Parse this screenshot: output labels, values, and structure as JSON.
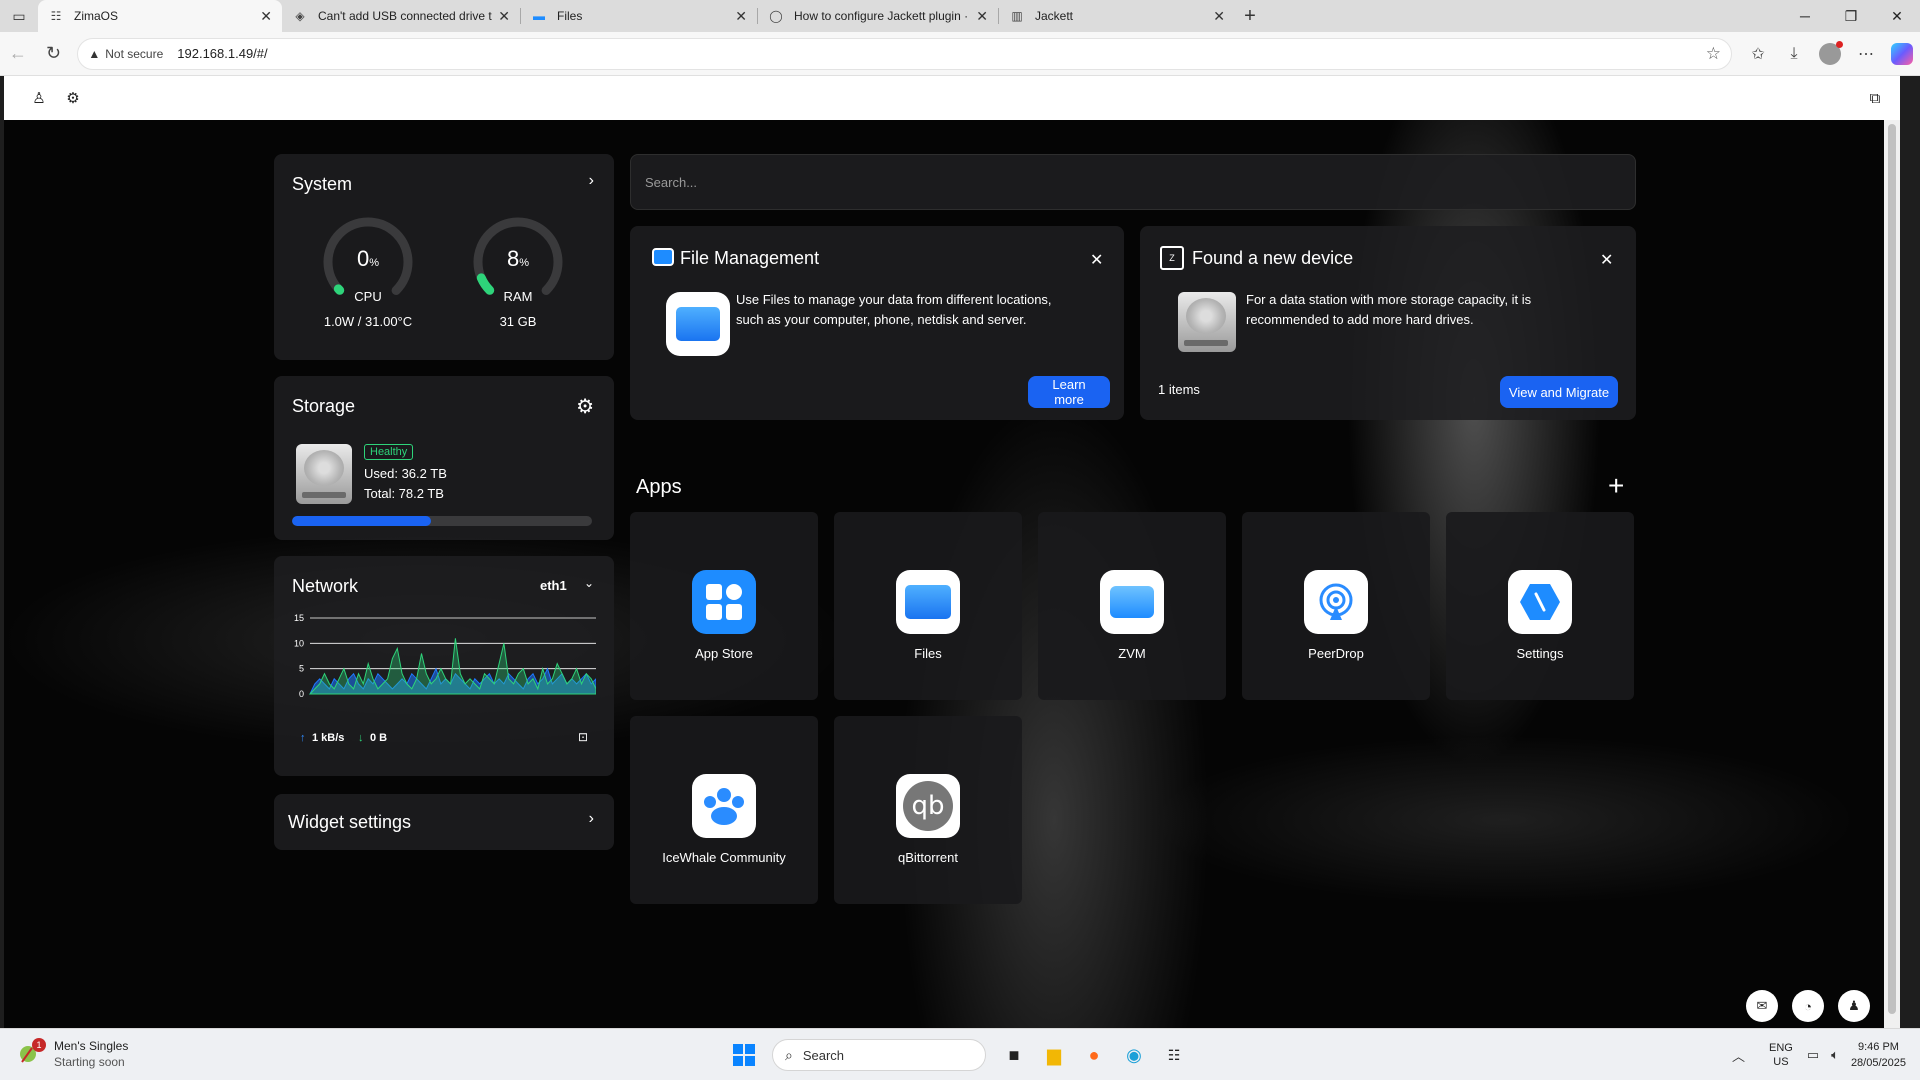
{
  "browser": {
    "tabs": [
      {
        "title": "ZimaOS",
        "icon": "zima-icon",
        "active": true
      },
      {
        "title": "Can't add USB connected drive to",
        "icon": "forum-icon",
        "active": false
      },
      {
        "title": "Files",
        "icon": "files-icon",
        "active": false
      },
      {
        "title": "How to configure Jackett plugin ·",
        "icon": "github-icon",
        "active": false
      },
      {
        "title": "Jackett",
        "icon": "jackett-icon",
        "active": false
      }
    ],
    "not_secure": "Not secure",
    "url": "192.168.1.49/#/"
  },
  "system": {
    "title": "System",
    "cpu": {
      "value": "0",
      "unit": "%",
      "label": "CPU",
      "sub": "1.0W / 31.00°C",
      "percent": 0
    },
    "ram": {
      "value": "8",
      "unit": "%",
      "label": "RAM",
      "sub": "31 GB",
      "percent": 8
    },
    "accent": "#2ed47a"
  },
  "storage": {
    "title": "Storage",
    "status": "Healthy",
    "used": "Used: 36.2 TB",
    "total": "Total: 78.2 TB",
    "used_fraction": 0.463
  },
  "network": {
    "title": "Network",
    "interface": "eth1",
    "y_ticks": [
      "15",
      "10",
      "5",
      "0"
    ],
    "upload": "1 kB/s",
    "download": "0 B",
    "series_a": [
      0,
      1,
      2,
      4,
      2,
      1,
      3,
      5,
      2,
      1,
      4,
      2,
      6,
      3,
      1,
      2,
      3,
      7,
      9,
      4,
      2,
      1,
      3,
      8,
      4,
      2,
      3,
      5,
      3,
      2,
      11,
      4,
      2,
      3,
      2,
      1,
      4,
      3,
      2,
      6,
      10,
      3,
      2,
      4,
      5,
      2,
      3,
      1,
      5,
      2,
      3,
      6,
      4,
      2,
      3,
      5,
      2,
      4,
      3,
      1
    ],
    "series_b": [
      0,
      2,
      3,
      2,
      1,
      3,
      2,
      1,
      3,
      4,
      2,
      1,
      3,
      2,
      4,
      3,
      2,
      1,
      2,
      3,
      2,
      4,
      3,
      2,
      1,
      3,
      5,
      2,
      3,
      2,
      4,
      3,
      2,
      1,
      3,
      2,
      3,
      4,
      2,
      3,
      2,
      4,
      3,
      2,
      1,
      3,
      4,
      2,
      3,
      5,
      2,
      3,
      4,
      2,
      3,
      2,
      3,
      4,
      2,
      3
    ]
  },
  "widget_settings": {
    "title": "Widget settings"
  },
  "search": {
    "placeholder": "Search..."
  },
  "file_management": {
    "title": "File Management",
    "text_line1": "Use Files to manage your data from different locations,",
    "text_line2": "such as your computer, phone, netdisk and server.",
    "button": "Learn more"
  },
  "new_device": {
    "title": "Found a new device",
    "text_line1": "For a data station with more storage capacity, it is",
    "text_line2": "recommended to add more hard drives.",
    "items": "1 items",
    "button": "View and Migrate"
  },
  "apps": {
    "title": "Apps",
    "list": [
      {
        "name": "App Store",
        "icon": "app-store-icon",
        "color": "#1e8cff"
      },
      {
        "name": "Files",
        "icon": "folder-icon",
        "color": "#ffffff"
      },
      {
        "name": "ZVM",
        "icon": "zvm-icon",
        "color": "#ffffff"
      },
      {
        "name": "PeerDrop",
        "icon": "peerdrop-icon",
        "color": "#ffffff"
      },
      {
        "name": "Settings",
        "icon": "settings-app-icon",
        "color": "#ffffff"
      },
      {
        "name": "IceWhale Community",
        "icon": "community-icon",
        "color": "#ffffff"
      },
      {
        "name": "qBittorrent",
        "icon": "qbittorrent-icon",
        "color": "#ffffff"
      }
    ]
  },
  "taskbar": {
    "weather_title": "Men's Singles",
    "weather_sub": "Starting soon",
    "badge": "1",
    "search": "Search",
    "lang1": "ENG",
    "lang2": "US",
    "time": "9:46 PM",
    "date": "28/05/2025"
  }
}
